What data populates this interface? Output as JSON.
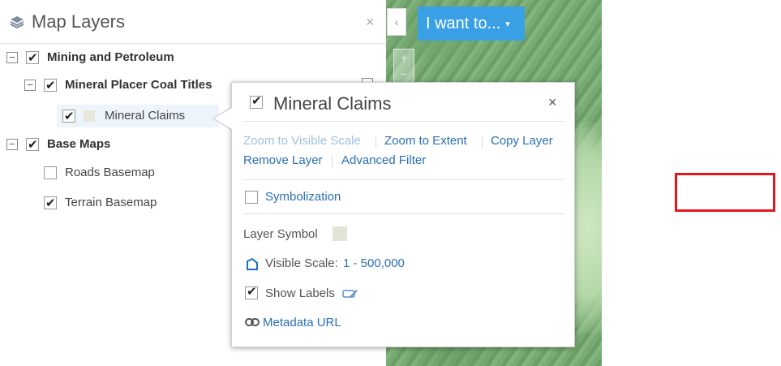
{
  "panel": {
    "title": "Map Layers",
    "close": "×",
    "tree": {
      "mining": "Mining and Petroleum",
      "mineral_placer": "Mineral Placer Coal Titles",
      "mineral_claims": "Mineral Claims",
      "base_maps": "Base Maps",
      "roads": "Roads Basemap",
      "terrain": "Terrain Basemap"
    }
  },
  "map": {
    "collapse_arrow": "‹",
    "zoom_in": "+",
    "zoom_out": "−",
    "want_button": "I want to...",
    "want_caret": "▾"
  },
  "popup": {
    "title": "Mineral Claims",
    "close": "×",
    "actions": {
      "zoom_visible": "Zoom to Visible Scale",
      "zoom_extent": "Zoom to Extent",
      "copy_layer": "Copy Layer",
      "remove_layer": "Remove Layer",
      "advanced_filter": "Advanced Filter"
    },
    "symbolization": "Symbolization",
    "layer_symbol": "Layer Symbol",
    "visible_scale_label": "Visible Scale:",
    "visible_scale_value": "1 - 500,000",
    "show_labels": "Show Labels",
    "metadata": "Metadata URL"
  },
  "colors": {
    "accent": "#3aa0e6",
    "link": "#2a6fb8",
    "highlight_rect": "#e5161b"
  }
}
